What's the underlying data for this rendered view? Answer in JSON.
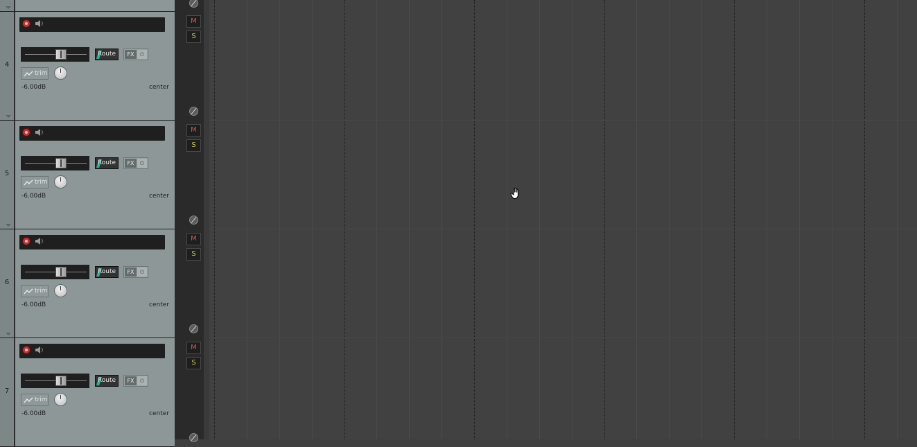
{
  "tracks": [
    {
      "number": "4",
      "buttons": {
        "route": "Route",
        "fx": "FX",
        "trim": "trim",
        "mute": "M",
        "solo": "S"
      },
      "volume": "-6.00dB",
      "pan": "center"
    },
    {
      "number": "5",
      "buttons": {
        "route": "Route",
        "fx": "FX",
        "trim": "trim",
        "mute": "M",
        "solo": "S"
      },
      "volume": "-6.00dB",
      "pan": "center"
    },
    {
      "number": "6",
      "buttons": {
        "route": "Route",
        "fx": "FX",
        "trim": "trim",
        "mute": "M",
        "solo": "S"
      },
      "volume": "-6.00dB",
      "pan": "center"
    },
    {
      "number": "7",
      "buttons": {
        "route": "Route",
        "fx": "FX",
        "trim": "trim",
        "mute": "M",
        "solo": "S"
      },
      "volume": "-6.00dB",
      "pan": "center"
    }
  ],
  "icons": {
    "record_arm": "record-arm-icon",
    "monitor": "speaker-icon",
    "power": "power-icon",
    "phase": "phase-invert-icon",
    "cursor": "hand-cursor-icon"
  },
  "colors": {
    "track_panel": "#8d9797",
    "arrange_bg": "#414141",
    "record_red": "#b13b3b",
    "route_accent": "#2bb39a",
    "mute_text": "#c95a5a",
    "solo_text": "#c8c85a"
  }
}
